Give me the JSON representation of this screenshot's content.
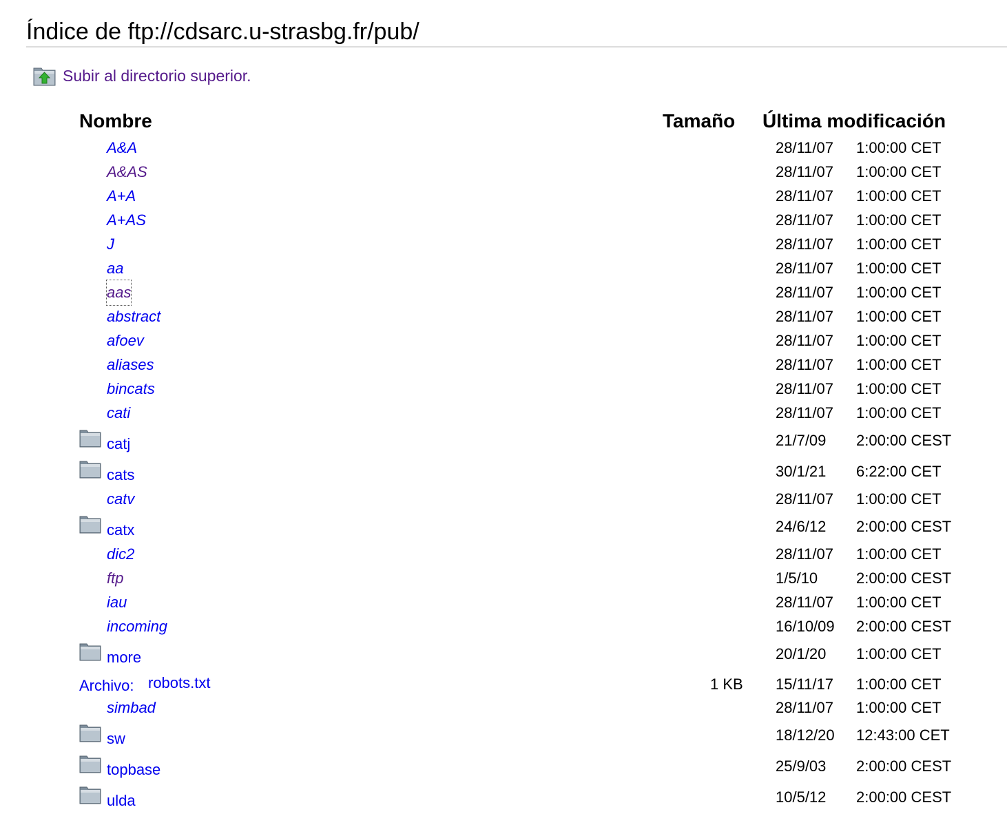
{
  "page": {
    "title": "Índice de ftp://cdsarc.u-strasbg.fr/pub/",
    "up_link_label": "Subir al directorio superior."
  },
  "columns": {
    "name": "Nombre",
    "size": "Tamaño",
    "modified": "Última modificación"
  },
  "file_prefix": "Archivo:",
  "colors": {
    "link": "#0000ee",
    "visited_link": "#551a8b",
    "header_rule": "#dcdcdc"
  },
  "entries": [
    {
      "name": "A&A",
      "kind": "symlink",
      "visited": false,
      "size": "",
      "date": "28/11/07",
      "time": "1:00:00 CET"
    },
    {
      "name": "A&AS",
      "kind": "symlink",
      "visited": true,
      "size": "",
      "date": "28/11/07",
      "time": "1:00:00 CET"
    },
    {
      "name": "A+A",
      "kind": "symlink",
      "visited": false,
      "size": "",
      "date": "28/11/07",
      "time": "1:00:00 CET"
    },
    {
      "name": "A+AS",
      "kind": "symlink",
      "visited": false,
      "size": "",
      "date": "28/11/07",
      "time": "1:00:00 CET"
    },
    {
      "name": "J",
      "kind": "symlink",
      "visited": false,
      "size": "",
      "date": "28/11/07",
      "time": "1:00:00 CET"
    },
    {
      "name": "aa",
      "kind": "symlink",
      "visited": false,
      "size": "",
      "date": "28/11/07",
      "time": "1:00:00 CET"
    },
    {
      "name": "aas",
      "kind": "symlink",
      "visited": true,
      "focused": true,
      "size": "",
      "date": "28/11/07",
      "time": "1:00:00 CET"
    },
    {
      "name": "abstract",
      "kind": "symlink",
      "visited": false,
      "size": "",
      "date": "28/11/07",
      "time": "1:00:00 CET"
    },
    {
      "name": "afoev",
      "kind": "symlink",
      "visited": false,
      "size": "",
      "date": "28/11/07",
      "time": "1:00:00 CET"
    },
    {
      "name": "aliases",
      "kind": "symlink",
      "visited": false,
      "size": "",
      "date": "28/11/07",
      "time": "1:00:00 CET"
    },
    {
      "name": "bincats",
      "kind": "symlink",
      "visited": false,
      "size": "",
      "date": "28/11/07",
      "time": "1:00:00 CET"
    },
    {
      "name": "cati",
      "kind": "symlink",
      "visited": false,
      "size": "",
      "date": "28/11/07",
      "time": "1:00:00 CET"
    },
    {
      "name": "catj",
      "kind": "dir",
      "visited": false,
      "size": "",
      "date": "21/7/09",
      "time": "2:00:00 CEST"
    },
    {
      "name": "cats",
      "kind": "dir",
      "visited": false,
      "size": "",
      "date": "30/1/21",
      "time": "6:22:00 CET"
    },
    {
      "name": "catv",
      "kind": "symlink",
      "visited": false,
      "size": "",
      "date": "28/11/07",
      "time": "1:00:00 CET"
    },
    {
      "name": "catx",
      "kind": "dir",
      "visited": false,
      "size": "",
      "date": "24/6/12",
      "time": "2:00:00 CEST"
    },
    {
      "name": "dic2",
      "kind": "symlink",
      "visited": false,
      "size": "",
      "date": "28/11/07",
      "time": "1:00:00 CET"
    },
    {
      "name": "ftp",
      "kind": "symlink",
      "visited": true,
      "size": "",
      "date": "1/5/10",
      "time": "2:00:00 CEST"
    },
    {
      "name": "iau",
      "kind": "symlink",
      "visited": false,
      "size": "",
      "date": "28/11/07",
      "time": "1:00:00 CET"
    },
    {
      "name": "incoming",
      "kind": "symlink",
      "visited": false,
      "size": "",
      "date": "16/10/09",
      "time": "2:00:00 CEST"
    },
    {
      "name": "more",
      "kind": "dir",
      "visited": false,
      "size": "",
      "date": "20/1/20",
      "time": "1:00:00 CET"
    },
    {
      "name": "robots.txt",
      "kind": "file",
      "visited": false,
      "size": "1 KB",
      "date": "15/11/17",
      "time": "1:00:00 CET"
    },
    {
      "name": "simbad",
      "kind": "symlink",
      "visited": false,
      "size": "",
      "date": "28/11/07",
      "time": "1:00:00 CET"
    },
    {
      "name": "sw",
      "kind": "dir",
      "visited": false,
      "size": "",
      "date": "18/12/20",
      "time": "12:43:00 CET"
    },
    {
      "name": "topbase",
      "kind": "dir",
      "visited": false,
      "size": "",
      "date": "25/9/03",
      "time": "2:00:00 CEST"
    },
    {
      "name": "ulda",
      "kind": "dir",
      "visited": false,
      "size": "",
      "date": "10/5/12",
      "time": "2:00:00 CEST"
    }
  ]
}
